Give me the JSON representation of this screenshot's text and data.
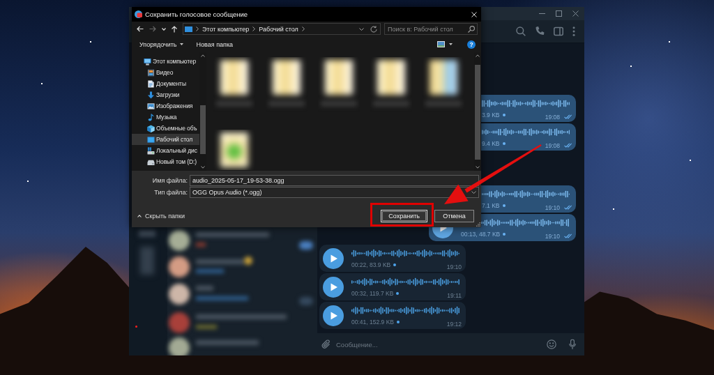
{
  "messenger": {
    "messages": [
      {
        "kind": "outgoing",
        "covered": true,
        "gap_before": false,
        "meta": "3.9 KB",
        "unplayed": true,
        "time": "19:08",
        "read": true
      },
      {
        "kind": "outgoing",
        "covered": true,
        "gap_before": false,
        "meta": "9.4 KB",
        "unplayed": true,
        "time": "19:08",
        "read": true
      },
      {
        "kind": "outgoing",
        "covered": true,
        "gap_before": true,
        "meta": "7.1 KB",
        "unplayed": true,
        "time": "19:10",
        "read": true
      },
      {
        "kind": "outgoing",
        "covered": false,
        "gap_before": false,
        "meta": "00:13, 48.7 KB",
        "unplayed": true,
        "time": "19:10",
        "read": true
      },
      {
        "kind": "incoming",
        "covered": false,
        "gap_before": false,
        "meta": "00:22, 83.9 KB",
        "unplayed": true,
        "time": "19:10",
        "read": false
      },
      {
        "kind": "incoming",
        "covered": false,
        "gap_before": false,
        "meta": "00:32, 119.7 KB",
        "unplayed": true,
        "time": "19:11",
        "read": false
      },
      {
        "kind": "incoming",
        "covered": false,
        "gap_before": false,
        "meta": "00:41, 152.9 KB",
        "unplayed": true,
        "time": "19:12",
        "read": false
      }
    ],
    "composer": {
      "placeholder": "Сообщение..."
    }
  },
  "dialog": {
    "title": "Сохранить голосовое сообщение",
    "nav_buttons": [
      {
        "kind": "back",
        "disabled": false
      },
      {
        "kind": "forward",
        "disabled": true
      },
      {
        "kind": "recent",
        "disabled": false
      },
      {
        "kind": "up",
        "disabled": false
      }
    ],
    "breadcrumb": [
      "Этот компьютер",
      "Рабочий стол"
    ],
    "search": {
      "placeholder": "Поиск в: Рабочий стол"
    },
    "toolbar": [
      {
        "label": "Упорядочить",
        "dropdown": true
      },
      {
        "label": "Новая папка",
        "dropdown": false
      }
    ],
    "help": {
      "label": "?"
    },
    "nav_tree": [
      {
        "label": "Этот компьютер",
        "kind": "computer",
        "selected": false,
        "children": [
          {
            "label": "Видео",
            "kind": "video",
            "selected": false
          },
          {
            "label": "Документы",
            "kind": "documents",
            "selected": false
          },
          {
            "label": "Загрузки",
            "kind": "downloads",
            "selected": false
          },
          {
            "label": "Изображения",
            "kind": "pictures",
            "selected": false
          },
          {
            "label": "Музыка",
            "kind": "music",
            "selected": false
          },
          {
            "label": "Объемные объ",
            "kind": "objects3d",
            "selected": false
          },
          {
            "label": "Рабочий стол",
            "kind": "desktop",
            "selected": true
          },
          {
            "label": "Локальный дис",
            "kind": "system-drive",
            "selected": false
          },
          {
            "label": "Новый том (D:)",
            "kind": "drive",
            "selected": false
          }
        ]
      }
    ],
    "files": [
      {
        "kind": "document"
      },
      {
        "kind": "document"
      },
      {
        "kind": "document"
      },
      {
        "kind": "document"
      },
      {
        "kind": "picture"
      },
      {
        "kind": "sheet"
      }
    ],
    "file_name": {
      "label": "Имя файла:",
      "value": "audio_2025-05-17_19-53-38.ogg"
    },
    "file_type": {
      "label": "Тип файла:",
      "value": "OGG Opus Audio (*.ogg)"
    },
    "hide_folders": {
      "label": "Скрыть папки"
    },
    "buttons": [
      {
        "label": "Сохранить",
        "default": true,
        "highlighted": true
      },
      {
        "label": "Отмена",
        "default": false,
        "highlighted": false
      }
    ]
  }
}
